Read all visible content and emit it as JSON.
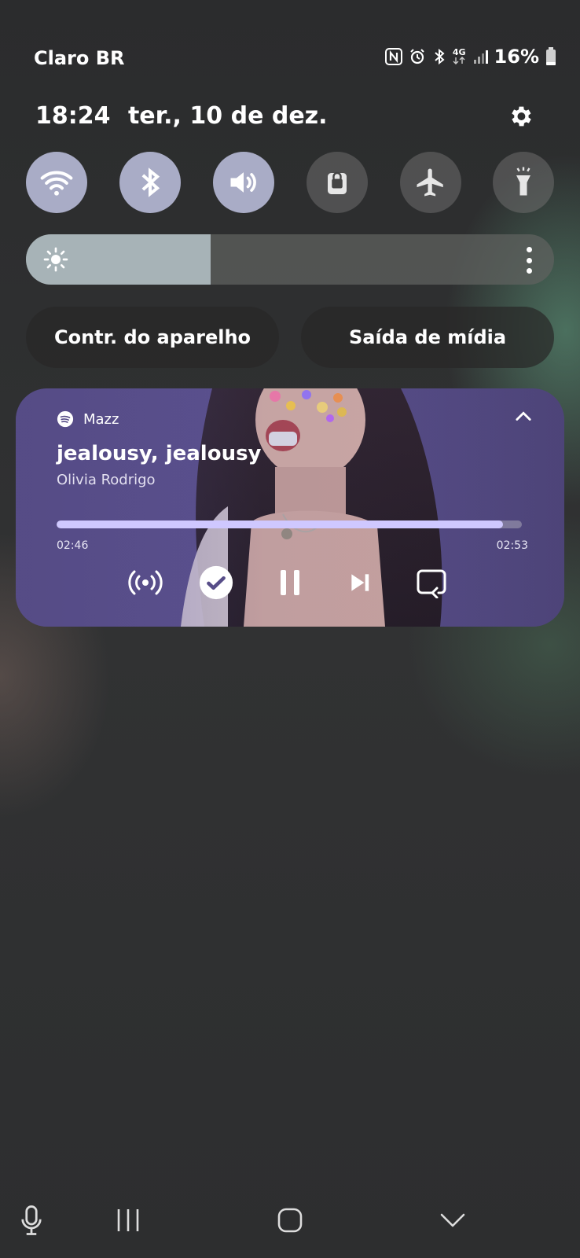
{
  "status_bar": {
    "carrier": "Claro BR",
    "network": "4G",
    "battery_percent": "16%",
    "icons": [
      "nfc-icon",
      "alarm-icon",
      "bluetooth-icon",
      "network-4g-icon",
      "signal-icon",
      "battery-icon"
    ]
  },
  "header": {
    "time": "18:24",
    "date": "ter., 10 de dez.",
    "settings_icon": "gear-icon"
  },
  "quick_settings": {
    "tiles": [
      {
        "name": "wifi",
        "icon": "wifi-icon",
        "active": true
      },
      {
        "name": "bluetooth",
        "icon": "bluetooth-icon",
        "active": true
      },
      {
        "name": "sound",
        "icon": "speaker-icon",
        "active": true
      },
      {
        "name": "screen-lock",
        "icon": "lock-icon",
        "active": false
      },
      {
        "name": "airplane-mode",
        "icon": "airplane-icon",
        "active": false
      },
      {
        "name": "flashlight",
        "icon": "flashlight-icon",
        "active": false
      }
    ],
    "brightness_level": 0.35,
    "device_control_label": "Contr. do aparelho",
    "media_output_label": "Saída de mídia"
  },
  "media": {
    "app_name": "Mazz",
    "app_icon": "spotify-icon",
    "title": "jealousy, jealousy",
    "artist": "Olivia Rodrigo",
    "elapsed": "02:46",
    "duration": "02:53",
    "progress_fraction": 0.96,
    "colors": {
      "card": "#574d88",
      "progress": "#cfc8ff"
    }
  },
  "nav_bar": {
    "icons": [
      "microphone-icon",
      "recent-apps-icon",
      "home-icon",
      "collapse-icon"
    ]
  }
}
